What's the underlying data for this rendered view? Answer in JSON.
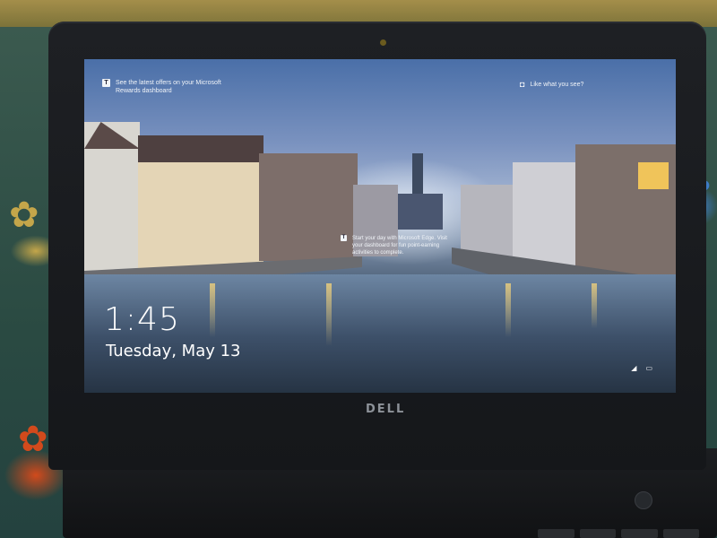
{
  "notifications": {
    "rewards_text": "See the latest offers on your Microsoft Rewards dashboard",
    "like_text": "Like what you see?",
    "mid_text": "Start your day with Microsoft Edge. Visit your dashboard for fun point-earning activities to complete."
  },
  "lockscreen": {
    "time": "1:45",
    "date": "Tuesday, May 13"
  },
  "laptop": {
    "brand": "DELL"
  },
  "icons": {
    "rewards": "rewards-trophy-icon",
    "camera": "camera-icon",
    "network": "network-icon",
    "battery": "battery-icon"
  },
  "colors": {
    "accent_text": "#ffffff",
    "bezel": "#1a1c1f"
  }
}
